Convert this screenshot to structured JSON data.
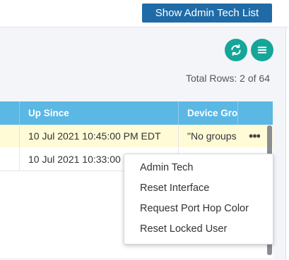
{
  "toolbar": {
    "admin_tech_button": "Show Admin Tech List",
    "refresh_icon": "refresh-icon",
    "menu_icon": "hamburger-menu-icon",
    "accent_color": "#15a69a"
  },
  "grid": {
    "total_rows": "Total Rows: 2 of 64",
    "columns": [
      "Up Since",
      "Device Gro"
    ],
    "rows": [
      {
        "up_since": "10 Jul 2021 10:45:00 PM EDT",
        "device_group": "\"No groups"
      },
      {
        "up_since": "10 Jul 2021 10:33:00",
        "device_group": ""
      }
    ],
    "header_color": "#5bb7e3"
  },
  "context_menu": {
    "items": [
      "Admin Tech",
      "Reset Interface",
      "Request Port Hop Color",
      "Reset Locked User"
    ]
  }
}
